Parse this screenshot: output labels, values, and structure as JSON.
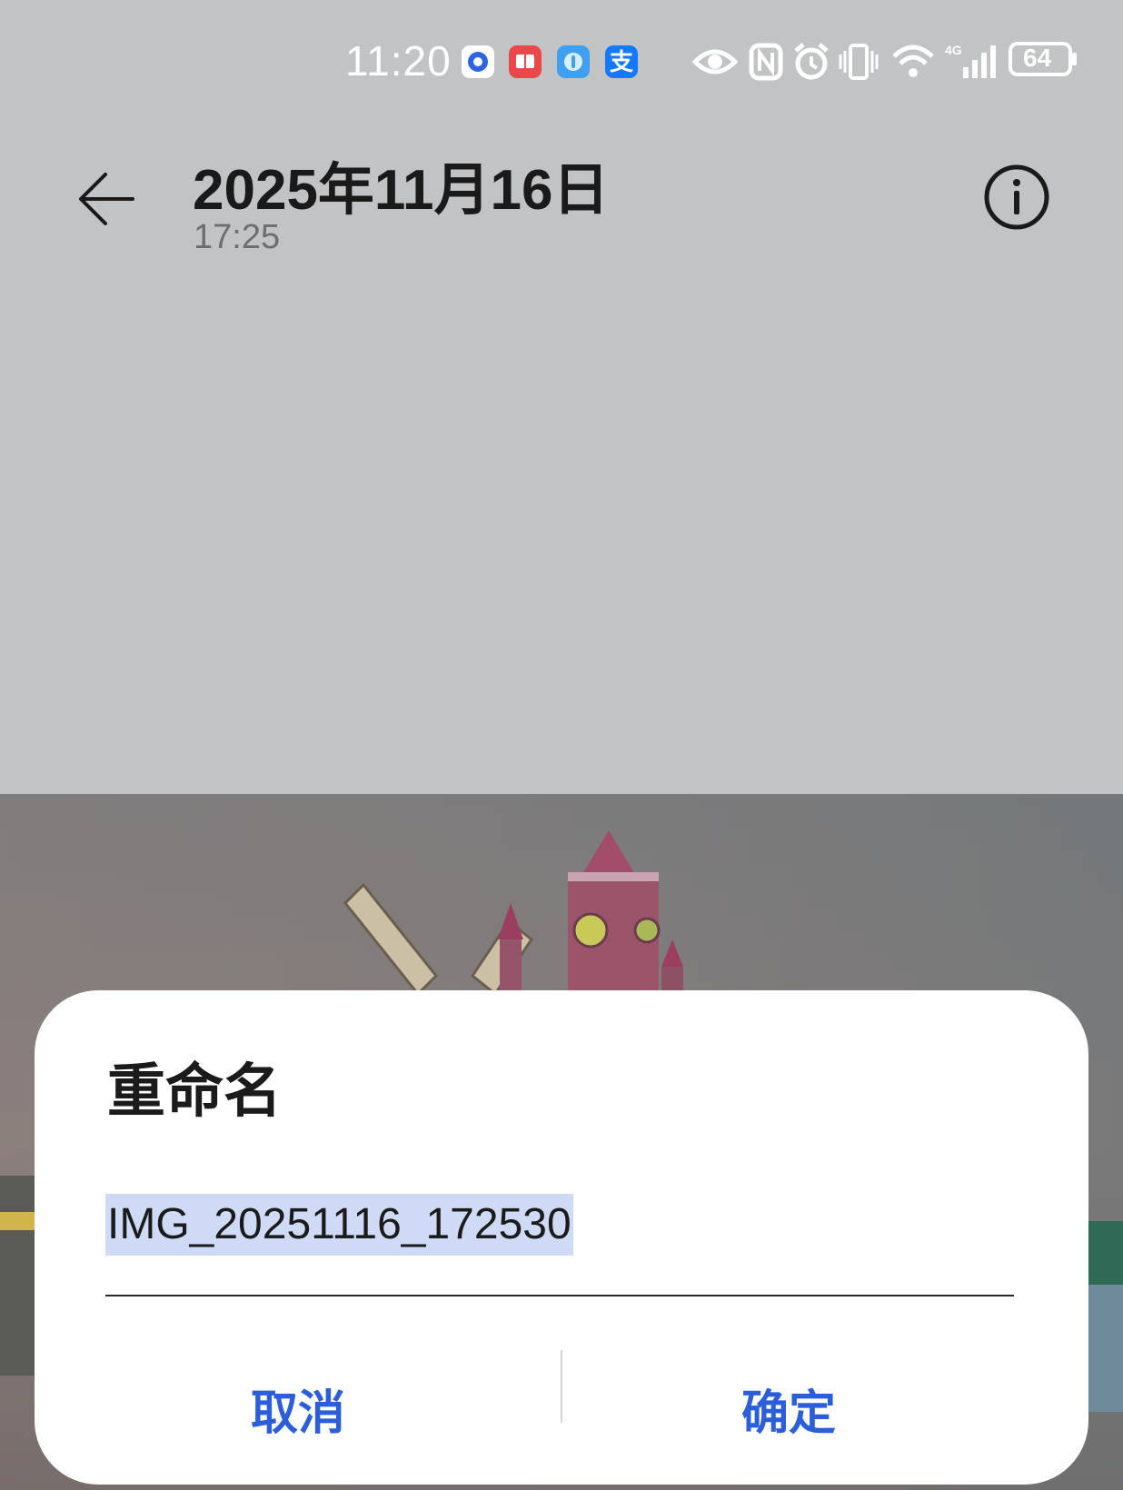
{
  "status_bar": {
    "time": "11:20",
    "battery": "64",
    "network": "4G",
    "notification_icons": [
      "location-app-icon",
      "reader-app-icon",
      "music-app-icon",
      "alipay-icon"
    ],
    "alipay_glyph": "支",
    "system_icons": [
      "eye-icon",
      "nfc-icon",
      "alarm-icon",
      "vibrate-icon",
      "wifi-icon",
      "cell-signal-icon",
      "battery-icon"
    ]
  },
  "header": {
    "title": "2025年11月16日",
    "subtitle": "17:25",
    "back_icon": "back-arrow-icon",
    "info_icon": "info-icon"
  },
  "dialog": {
    "title": "重命名",
    "filename": "IMG_20251116_172530",
    "cancel_label": "取消",
    "confirm_label": "确定",
    "accent_color": "#2b5ed8",
    "selection_color": "#cfdbf6"
  }
}
